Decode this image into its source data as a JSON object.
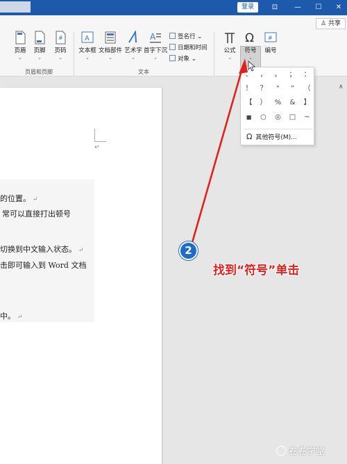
{
  "titlebar": {
    "login": "登录",
    "controls": [
      "⊡",
      "—",
      "☐",
      "✕"
    ]
  },
  "ribbon": {
    "share": "♙ 共享",
    "groups": [
      {
        "label": "页眉和页脚",
        "buttons": [
          "页眉",
          "页脚",
          "页码"
        ]
      },
      {
        "label": "文本",
        "buttons": [
          "文本框",
          "文档部件",
          "艺术字",
          "首字下沉"
        ]
      },
      {
        "label": "",
        "buttons": [
          "公式",
          "符号",
          "编号"
        ]
      }
    ],
    "text_small": [
      "签名行",
      "日期和时间",
      "对象"
    ],
    "collapse": "∧"
  },
  "doc": {
    "paragraph_mark": "↵",
    "lines": [
      "的位置。",
      "常可以直接打出顿号",
      "切换到中文输入状态。",
      "击即可输入到 Word 文档",
      "中。"
    ]
  },
  "symbol_popup": {
    "symbols": [
      "、",
      "，",
      "。",
      "；",
      "：",
      "！",
      "？",
      "“",
      "”",
      "（",
      "【",
      "）",
      "%",
      "&",
      "】",
      "■",
      "○",
      "◎",
      "□",
      "~"
    ],
    "more": "其他符号(M)..."
  },
  "annotation": {
    "step": "2",
    "text": "找到“符号”单击",
    "color": "#e0211d"
  },
  "watermark": "卷卷学堂"
}
